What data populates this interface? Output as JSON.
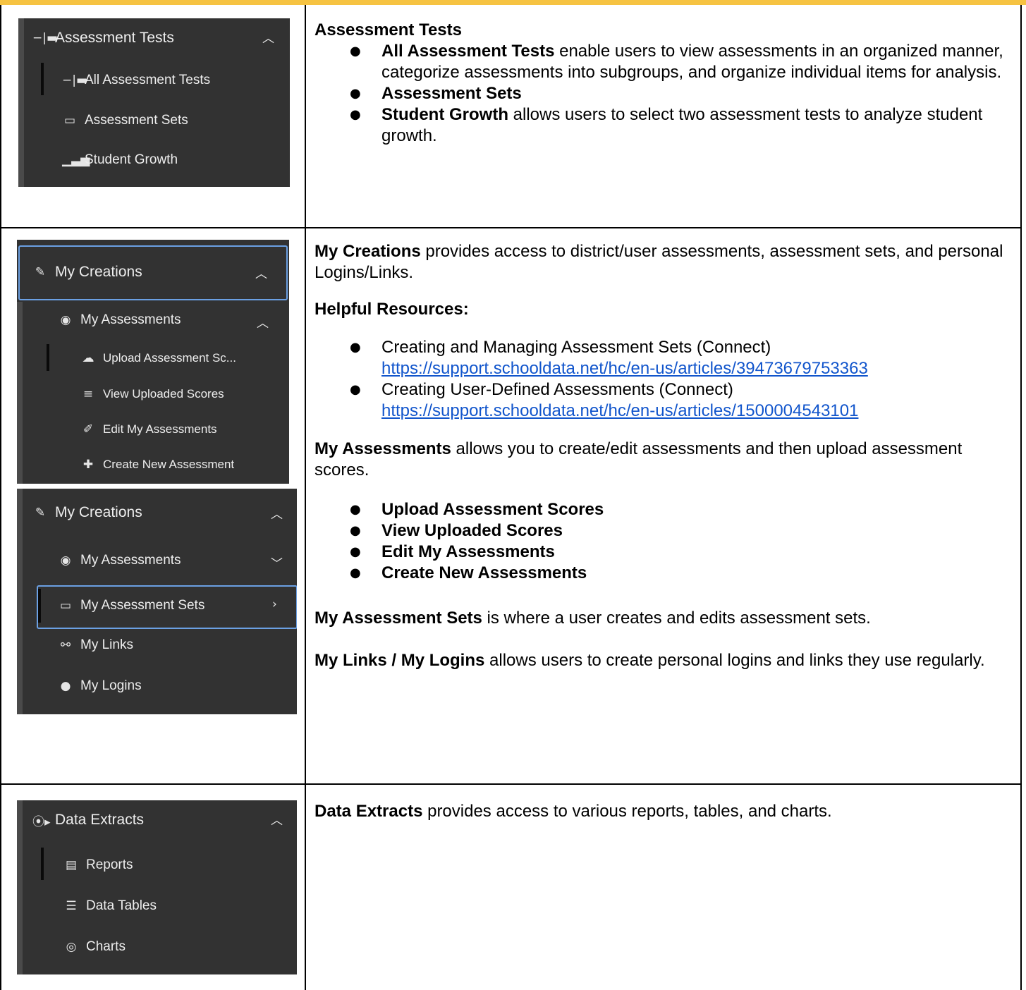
{
  "colors": {
    "accent_bar": "#f6c342",
    "sidebar_bg": "#323232",
    "link": "#1155cc",
    "highlight_border": "#6ba0e3"
  },
  "row1": {
    "sidebar": {
      "header": {
        "icon": "assessment-tests-icon",
        "label": "Assessment Tests"
      },
      "items": [
        {
          "icon": "assessment-tests-icon",
          "label": "All Assessment Tests"
        },
        {
          "icon": "assessment-sets-icon",
          "label": "Assessment Sets"
        },
        {
          "icon": "student-growth-icon",
          "label": "Student Growth"
        }
      ]
    },
    "title": "Assessment Tests",
    "bullets": [
      {
        "bold": "All Assessment Tests",
        "text": " enable users to view assessments in an organized manner, categorize assessments into subgroups, and organize individual items for analysis."
      },
      {
        "bold": "Assessment Sets",
        "text": ""
      },
      {
        "bold": "Student Growth",
        "text": " allows users to select two assessment tests to analyze student growth."
      }
    ]
  },
  "row2": {
    "sidebar_a": {
      "header": {
        "icon": "my-creations-icon",
        "label": "My Creations"
      },
      "sub": {
        "icon": "my-assessments-icon",
        "label": "My Assessments"
      },
      "items": [
        {
          "icon": "upload-icon",
          "label": "Upload Assessment Sc..."
        },
        {
          "icon": "view-scores-icon",
          "label": "View Uploaded Scores"
        },
        {
          "icon": "edit-icon",
          "label": "Edit My Assessments"
        },
        {
          "icon": "create-icon",
          "label": "Create New Assessment"
        }
      ]
    },
    "sidebar_b": {
      "header": {
        "icon": "my-creations-icon",
        "label": "My Creations"
      },
      "items": [
        {
          "icon": "my-assessments-icon",
          "label": "My Assessments"
        },
        {
          "icon": "assessment-sets-icon",
          "label": "My Assessment Sets"
        },
        {
          "icon": "link-icon",
          "label": "My Links"
        },
        {
          "icon": "user-icon",
          "label": "My Logins"
        }
      ]
    },
    "intro": {
      "bold": "My Creations",
      "text": " provides access to district/user assessments, assessment sets, and personal Logins/Links."
    },
    "resources_heading": "Helpful Resources:",
    "resources": [
      {
        "text": "Creating and Managing Assessment Sets (Connect)",
        "url": "https://support.schooldata.net/hc/en-us/articles/39473679753363"
      },
      {
        "text": "Creating User-Defined Assessments (Connect)",
        "url": "https://support.schooldata.net/hc/en-us/articles/1500004543101"
      }
    ],
    "assessments": {
      "bold": "My Assessments",
      "text": " allows you to create/edit assessments and then upload assessment scores."
    },
    "assessment_items": [
      "Upload Assessment Scores",
      "View Uploaded Scores",
      "Edit My Assessments",
      "Create New Assessments"
    ],
    "sets": {
      "bold": "My Assessment Sets",
      "text": " is where a user creates and edits assessment sets."
    },
    "links": {
      "bold": "My Links / My Logins",
      "text": " allows users to create personal logins and links they use regularly."
    }
  },
  "row3": {
    "sidebar": {
      "header": {
        "icon": "data-extracts-icon",
        "label": "Data Extracts"
      },
      "items": [
        {
          "icon": "reports-icon",
          "label": "Reports"
        },
        {
          "icon": "data-tables-icon",
          "label": "Data Tables"
        },
        {
          "icon": "charts-icon",
          "label": "Charts"
        }
      ]
    },
    "intro": {
      "bold": "Data Extracts",
      "text": " provides access to various reports, tables, and charts."
    }
  }
}
